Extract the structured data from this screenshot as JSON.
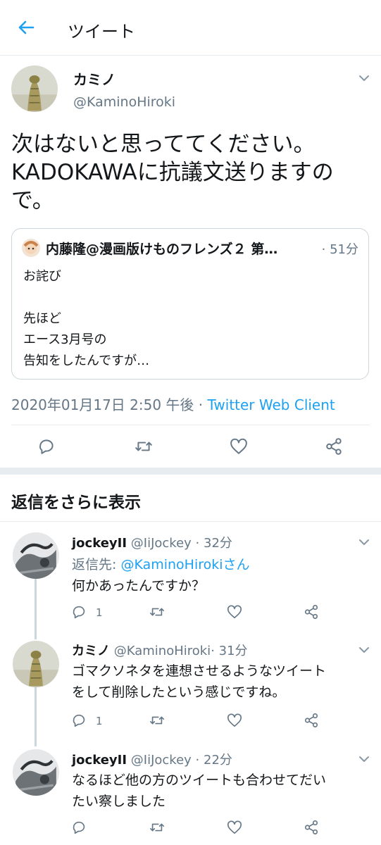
{
  "header": {
    "title": "ツイート"
  },
  "tweet": {
    "name": "カミノ",
    "handle": "@KaminoHiroki",
    "text_lines": [
      "次はないと思っててください。",
      "KADOKAWAに抗議文送りますの",
      "で。"
    ],
    "quoted": {
      "name": "内藤隆@漫画版けものフレンズ２ 第…",
      "time": "· 51分",
      "lines": [
        "お詫び",
        "",
        "先ほど",
        "エース3月号の",
        "告知をしたんですが…"
      ]
    },
    "timestamp": "2020年01月17日 2:50 午後 · ",
    "client": "Twitter Web Client"
  },
  "more_replies": {
    "title": "返信をさらに表示"
  },
  "replies": [
    {
      "name": "jockeyII",
      "handle": "@IiJockey",
      "time": "· 32分",
      "reply_to_label": "返信先: ",
      "reply_to_handle": "@KaminoHirokiさん",
      "lines": [
        "何かあったんですか？"
      ],
      "reply_count": "1"
    },
    {
      "name": "カミノ",
      "handle": "@KaminoHiroki",
      "time": "· 31分",
      "lines": [
        "ゴマクソネタを連想させるようなツイート",
        "をして削除したという感じですね。"
      ],
      "reply_count": "1"
    },
    {
      "name": "jockeyII",
      "handle": "@IiJockey",
      "time": "· 22分",
      "lines": [
        "なるほど他の方のツイートも合わせてだい",
        "たい察しました"
      ],
      "reply_count": ""
    }
  ],
  "colors": {
    "accent": "#1da1f2",
    "muted": "#657786",
    "border": "#e6ecf0",
    "text": "#14171a"
  },
  "icons": [
    "back-arrow-icon",
    "chevron-down-icon",
    "reply-icon",
    "retweet-icon",
    "like-icon",
    "share-icon"
  ]
}
